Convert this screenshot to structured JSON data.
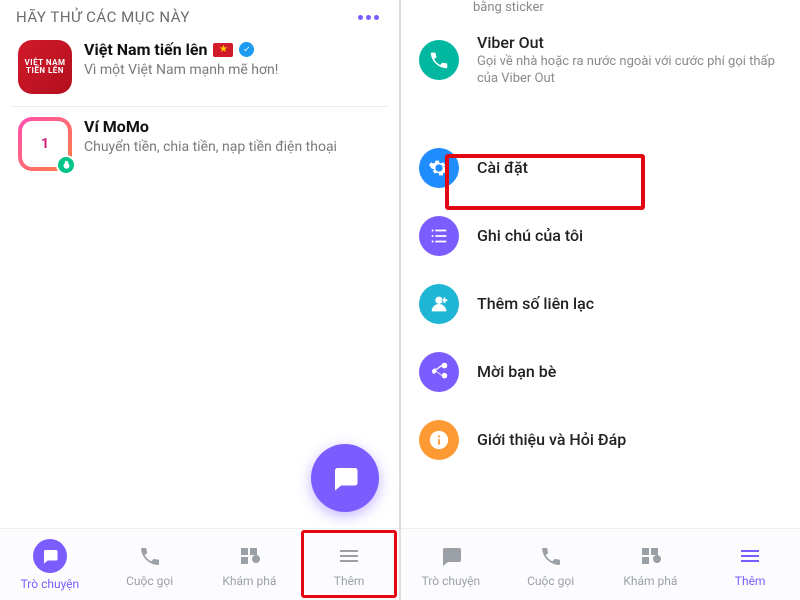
{
  "left": {
    "section_header": "HÃY THỬ CÁC MỤC NÀY",
    "cards": [
      {
        "title": "Việt Nam tiến lên",
        "subtitle": "Vì một Việt Nam mạnh mẽ hơn!",
        "icon_text": "VIỆT NAM\nTIẾN LÊN",
        "has_flag": true,
        "verified": true
      },
      {
        "title": "Ví MoMo",
        "subtitle": "Chuyển tiền, chia tiền, nạp tiền điện thoại",
        "icon_badge_text": "1"
      }
    ],
    "nav": [
      {
        "label": "Trò chuyện",
        "icon": "chat",
        "active": true
      },
      {
        "label": "Cuộc gọi",
        "icon": "phone",
        "active": false
      },
      {
        "label": "Khám phá",
        "icon": "explore",
        "active": false
      },
      {
        "label": "Thêm",
        "icon": "more",
        "active": false
      }
    ],
    "highlight_nav_index": 3
  },
  "right": {
    "partial_text": "bằng sticker",
    "viber_out": {
      "title": "Viber Out",
      "subtitle": "Gọi về nhà hoặc ra nước ngoài với cước phí gọi thấp của Viber Out"
    },
    "menu": [
      {
        "label": "Cài đặt",
        "icon": "settings",
        "color": "c-blue",
        "highlight": true
      },
      {
        "label": "Ghi chú của tôi",
        "icon": "notes",
        "color": "c-purple"
      },
      {
        "label": "Thêm số liên lạc",
        "icon": "addcontact",
        "color": "c-cyan"
      },
      {
        "label": "Mời bạn bè",
        "icon": "share",
        "color": "c-purple"
      },
      {
        "label": "Giới thiệu và Hỏi Đáp",
        "icon": "info",
        "color": "c-orange"
      }
    ],
    "nav": [
      {
        "label": "Trò chuyện",
        "icon": "chat",
        "active": false
      },
      {
        "label": "Cuộc gọi",
        "icon": "phone",
        "active": false
      },
      {
        "label": "Khám phá",
        "icon": "explore",
        "active": false
      },
      {
        "label": "Thêm",
        "icon": "more",
        "active": true
      }
    ]
  },
  "icons": {
    "chat": "chat-bubble-icon",
    "phone": "phone-icon",
    "explore": "grid-icon",
    "more": "hamburger-icon",
    "settings": "gear-icon",
    "notes": "list-icon",
    "addcontact": "add-person-icon",
    "share": "share-icon",
    "info": "info-icon",
    "fab": "new-chat-icon",
    "verified": "checkmark-icon"
  },
  "colors": {
    "accent": "#7b5cff",
    "highlight_border": "#e30613"
  }
}
